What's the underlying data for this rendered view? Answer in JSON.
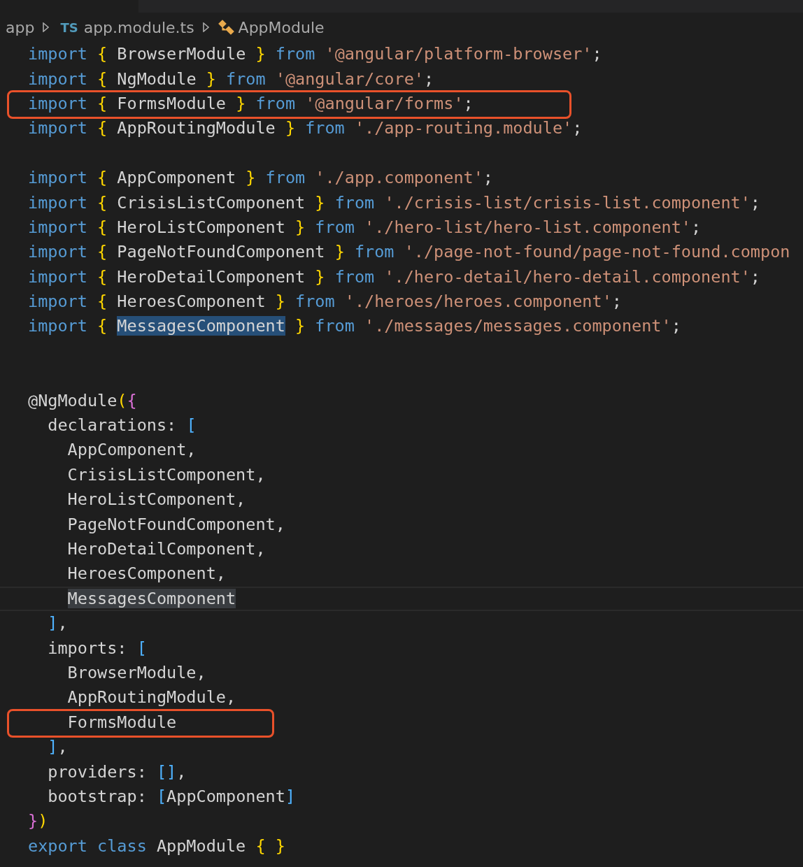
{
  "breadcrumb": {
    "folder": "app",
    "file_badge": "TS",
    "file": "app.module.ts",
    "symbol": "AppModule"
  },
  "lines": [
    {
      "current": false,
      "boxed": false,
      "tokens": [
        {
          "kind": "keyword",
          "text": "import "
        },
        {
          "kind": "brace",
          "text": "{"
        },
        {
          "kind": "plain",
          "text": " BrowserModule "
        },
        {
          "kind": "brace",
          "text": "}"
        },
        {
          "kind": "keyword",
          "text": " from "
        },
        {
          "kind": "string",
          "text": "'@angular/platform-browser'"
        },
        {
          "kind": "plain",
          "text": ";"
        }
      ]
    },
    {
      "current": false,
      "boxed": false,
      "tokens": [
        {
          "kind": "keyword",
          "text": "import "
        },
        {
          "kind": "brace",
          "text": "{"
        },
        {
          "kind": "plain",
          "text": " NgModule "
        },
        {
          "kind": "brace",
          "text": "}"
        },
        {
          "kind": "keyword",
          "text": " from "
        },
        {
          "kind": "string",
          "text": "'@angular/core'"
        },
        {
          "kind": "plain",
          "text": ";"
        }
      ]
    },
    {
      "current": false,
      "boxed": true,
      "tokens": [
        {
          "kind": "keyword",
          "text": "import "
        },
        {
          "kind": "brace",
          "text": "{"
        },
        {
          "kind": "plain",
          "text": " FormsModule "
        },
        {
          "kind": "brace",
          "text": "}"
        },
        {
          "kind": "keyword",
          "text": " from "
        },
        {
          "kind": "string",
          "text": "'@angular/forms'"
        },
        {
          "kind": "plain",
          "text": ";"
        }
      ]
    },
    {
      "current": false,
      "boxed": false,
      "tokens": [
        {
          "kind": "keyword",
          "text": "import "
        },
        {
          "kind": "brace",
          "text": "{"
        },
        {
          "kind": "plain",
          "text": " AppRoutingModule "
        },
        {
          "kind": "brace",
          "text": "}"
        },
        {
          "kind": "keyword",
          "text": " from "
        },
        {
          "kind": "string",
          "text": "'./app-routing.module'"
        },
        {
          "kind": "plain",
          "text": ";"
        }
      ]
    },
    {
      "current": false,
      "boxed": false
    },
    {
      "current": false,
      "boxed": false,
      "tokens": [
        {
          "kind": "keyword",
          "text": "import "
        },
        {
          "kind": "brace",
          "text": "{"
        },
        {
          "kind": "plain",
          "text": " AppComponent "
        },
        {
          "kind": "brace",
          "text": "}"
        },
        {
          "kind": "keyword",
          "text": " from "
        },
        {
          "kind": "string",
          "text": "'./app.component'"
        },
        {
          "kind": "plain",
          "text": ";"
        }
      ]
    },
    {
      "current": false,
      "boxed": false,
      "tokens": [
        {
          "kind": "keyword",
          "text": "import "
        },
        {
          "kind": "brace",
          "text": "{"
        },
        {
          "kind": "plain",
          "text": " CrisisListComponent "
        },
        {
          "kind": "brace",
          "text": "}"
        },
        {
          "kind": "keyword",
          "text": " from "
        },
        {
          "kind": "string",
          "text": "'./crisis-list/crisis-list.component'"
        },
        {
          "kind": "plain",
          "text": ";"
        }
      ]
    },
    {
      "current": false,
      "boxed": false,
      "tokens": [
        {
          "kind": "keyword",
          "text": "import "
        },
        {
          "kind": "brace",
          "text": "{"
        },
        {
          "kind": "plain",
          "text": " HeroListComponent "
        },
        {
          "kind": "brace",
          "text": "}"
        },
        {
          "kind": "keyword",
          "text": " from "
        },
        {
          "kind": "string",
          "text": "'./hero-list/hero-list.component'"
        },
        {
          "kind": "plain",
          "text": ";"
        }
      ]
    },
    {
      "current": false,
      "boxed": false,
      "tokens": [
        {
          "kind": "keyword",
          "text": "import "
        },
        {
          "kind": "brace",
          "text": "{"
        },
        {
          "kind": "plain",
          "text": " PageNotFoundComponent "
        },
        {
          "kind": "brace",
          "text": "}"
        },
        {
          "kind": "keyword",
          "text": " from "
        },
        {
          "kind": "string",
          "text": "'./page-not-found/page-not-found.compon"
        }
      ]
    },
    {
      "current": false,
      "boxed": false,
      "tokens": [
        {
          "kind": "keyword",
          "text": "import "
        },
        {
          "kind": "brace",
          "text": "{"
        },
        {
          "kind": "plain",
          "text": " HeroDetailComponent "
        },
        {
          "kind": "brace",
          "text": "}"
        },
        {
          "kind": "keyword",
          "text": " from "
        },
        {
          "kind": "string",
          "text": "'./hero-detail/hero-detail.component'"
        },
        {
          "kind": "plain",
          "text": ";"
        }
      ]
    },
    {
      "current": false,
      "boxed": false,
      "tokens": [
        {
          "kind": "keyword",
          "text": "import "
        },
        {
          "kind": "brace",
          "text": "{"
        },
        {
          "kind": "plain",
          "text": " HeroesComponent "
        },
        {
          "kind": "brace",
          "text": "}"
        },
        {
          "kind": "keyword",
          "text": " from "
        },
        {
          "kind": "string",
          "text": "'./heroes/heroes.component'"
        },
        {
          "kind": "plain",
          "text": ";"
        }
      ]
    },
    {
      "current": false,
      "boxed": false,
      "tokens": [
        {
          "kind": "keyword",
          "text": "import "
        },
        {
          "kind": "brace",
          "text": "{ "
        },
        {
          "kind": "selected",
          "text": "MessagesComponent"
        },
        {
          "kind": "brace",
          "text": " }"
        },
        {
          "kind": "keyword",
          "text": " from "
        },
        {
          "kind": "string",
          "text": "'./messages/messages.component'"
        },
        {
          "kind": "plain",
          "text": ";"
        }
      ]
    },
    {
      "current": false,
      "boxed": false
    },
    {
      "current": false,
      "boxed": false
    },
    {
      "current": false,
      "boxed": false,
      "tokens": [
        {
          "kind": "plain",
          "text": "@NgModule"
        },
        {
          "kind": "brace",
          "text": "("
        },
        {
          "kind": "paren",
          "text": "{"
        }
      ]
    },
    {
      "current": false,
      "boxed": false,
      "tokens": [
        {
          "kind": "plain",
          "text": "  declarations: "
        },
        {
          "kind": "bracket",
          "text": "["
        }
      ]
    },
    {
      "current": false,
      "boxed": false,
      "tokens": [
        {
          "kind": "plain",
          "text": "    AppComponent,"
        }
      ]
    },
    {
      "current": false,
      "boxed": false,
      "tokens": [
        {
          "kind": "plain",
          "text": "    CrisisListComponent,"
        }
      ]
    },
    {
      "current": false,
      "boxed": false,
      "tokens": [
        {
          "kind": "plain",
          "text": "    HeroListComponent,"
        }
      ]
    },
    {
      "current": false,
      "boxed": false,
      "tokens": [
        {
          "kind": "plain",
          "text": "    PageNotFoundComponent,"
        }
      ]
    },
    {
      "current": false,
      "boxed": false,
      "tokens": [
        {
          "kind": "plain",
          "text": "    HeroDetailComponent,"
        }
      ]
    },
    {
      "current": false,
      "boxed": false,
      "tokens": [
        {
          "kind": "plain",
          "text": "    HeroesComponent,"
        }
      ]
    },
    {
      "current": true,
      "boxed": false,
      "tokens": [
        {
          "kind": "match",
          "text": "    MessagesComponent"
        }
      ]
    },
    {
      "current": false,
      "boxed": false,
      "tokens": [
        {
          "kind": "bracket",
          "text": "  ]"
        },
        {
          "kind": "plain",
          "text": ","
        }
      ]
    },
    {
      "current": false,
      "boxed": false,
      "tokens": [
        {
          "kind": "plain",
          "text": "  imports: "
        },
        {
          "kind": "bracket",
          "text": "["
        }
      ]
    },
    {
      "current": false,
      "boxed": false,
      "tokens": [
        {
          "kind": "plain",
          "text": "    BrowserModule,"
        }
      ]
    },
    {
      "current": false,
      "boxed": false,
      "tokens": [
        {
          "kind": "plain",
          "text": "    AppRoutingModule,"
        }
      ]
    },
    {
      "current": false,
      "boxed": true,
      "tokens": [
        {
          "kind": "plain",
          "text": "    FormsModule"
        }
      ]
    },
    {
      "current": false,
      "boxed": false,
      "tokens": [
        {
          "kind": "bracket",
          "text": "  ]"
        },
        {
          "kind": "plain",
          "text": ","
        }
      ]
    },
    {
      "current": false,
      "boxed": false,
      "tokens": [
        {
          "kind": "plain",
          "text": "  providers: "
        },
        {
          "kind": "bracket",
          "text": "[]"
        },
        {
          "kind": "plain",
          "text": ","
        }
      ]
    },
    {
      "current": false,
      "boxed": false,
      "tokens": [
        {
          "kind": "plain",
          "text": "  bootstrap: "
        },
        {
          "kind": "bracket",
          "text": "["
        },
        {
          "kind": "plain",
          "text": "AppComponent"
        },
        {
          "kind": "bracket",
          "text": "]"
        }
      ]
    },
    {
      "current": false,
      "boxed": false,
      "tokens": [
        {
          "kind": "paren",
          "text": "}"
        },
        {
          "kind": "brace",
          "text": ")"
        }
      ]
    },
    {
      "current": false,
      "boxed": false,
      "tokens": [
        {
          "kind": "keyword",
          "text": "export class"
        },
        {
          "kind": "plain",
          "text": " AppModule "
        },
        {
          "kind": "brace",
          "text": "{ }"
        }
      ]
    }
  ]
}
